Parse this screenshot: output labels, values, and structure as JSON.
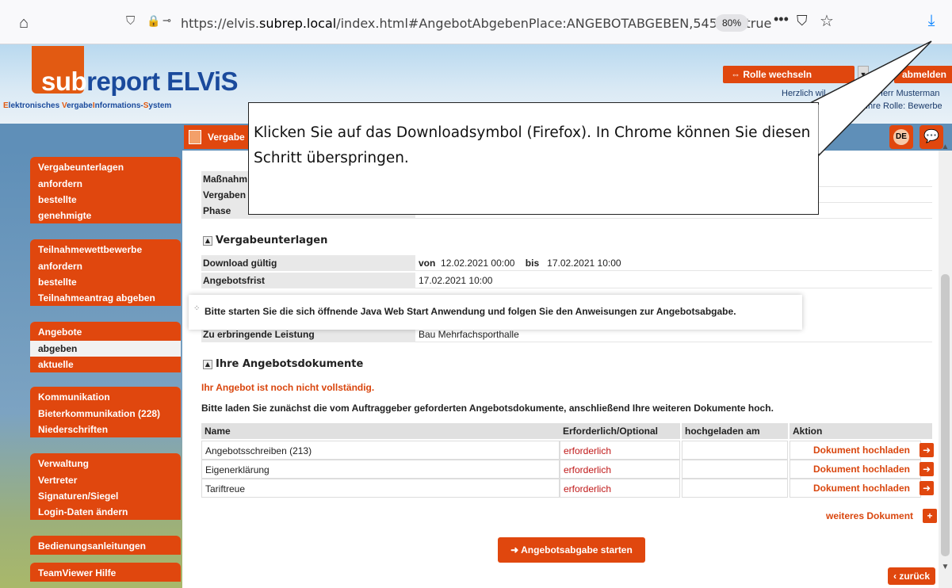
{
  "browser": {
    "url_prefix": "https://elvis.",
    "url_domain": "subrep.local",
    "url_suffix": "/index.html#AngebotAbgebenPlace:ANGEBOTABGEBEN,545673,true",
    "zoom": "80%"
  },
  "header": {
    "logo_sub": "sub",
    "logo_rest": "report ELViS",
    "logo_tagline_1": "E",
    "logo_tagline_2": "lektronisches ",
    "logo_tagline_3": "V",
    "logo_tagline_4": "ergabe",
    "logo_tagline_5": "I",
    "logo_tagline_6": "nformations-",
    "logo_tagline_7": "S",
    "logo_tagline_8": "ystem",
    "role_switch": "⇔ Rolle wechseln",
    "logout": "abmelden",
    "welcome": "Herzlich wil",
    "welcome_name": "Herr Musterman",
    "role_text": "Ihre Rolle: Bewerbe"
  },
  "nav": {
    "tab_label": "Vergabe",
    "lang": "DE"
  },
  "sidebar": {
    "groups": [
      {
        "title": "Vergabeunterlagen",
        "items": [
          "anfordern",
          "bestellte",
          "genehmigte"
        ]
      },
      {
        "title": "Teilnahmewettbewerbe",
        "items": [
          "anfordern",
          "bestellte",
          "Teilnahmeantrag abgeben"
        ]
      },
      {
        "title": "Angebote",
        "items": [
          "abgeben",
          "aktuelle"
        ]
      },
      {
        "title": "Kommunikation",
        "items": [
          "Bieterkommunikation (228)",
          "Niederschriften"
        ]
      },
      {
        "title": "Verwaltung",
        "items": [
          "Vertreter",
          "Signaturen/Siegel",
          "Login-Daten ändern"
        ]
      },
      {
        "title": "Bedienungsanleitungen",
        "items": []
      },
      {
        "title": "TeamViewer Hilfe",
        "items": []
      }
    ]
  },
  "main": {
    "top_rows": [
      {
        "key": "Maßnahm",
        "val": ""
      },
      {
        "key": "Vergaben",
        "val": ""
      },
      {
        "key": "Phase",
        "val": ""
      }
    ],
    "section_1": "Vergabeunterlagen",
    "download_key": "Download gültig",
    "download_von": "von",
    "download_from": "12.02.2021 00:00",
    "download_bis": "bis",
    "download_to": "17.02.2021 10:00",
    "deadline_key": "Angebotsfrist",
    "deadline_val": "17.02.2021 10:00",
    "service_key": "Zu erbringende Leistung",
    "service_val": "Bau Mehrfachsporthalle",
    "section_2": "Ihre Angebotsdokumente",
    "warning": "Ihr Angebot ist noch nicht vollständig.",
    "info": "Bitte laden Sie zunächst die vom Auftraggeber geforderten Angebotsdokumente, anschließend Ihre weiteren Dokumente hoch.",
    "table_headers": [
      "Name",
      "Erforderlich/Optional",
      "hochgeladen am",
      "Aktion"
    ],
    "table_rows": [
      {
        "name": "Angebotsschreiben (213)",
        "req": "erforderlich",
        "uploaded": "",
        "action": "Dokument hochladen"
      },
      {
        "name": "Eigenerklärung",
        "req": "erforderlich",
        "uploaded": "",
        "action": "Dokument hochladen"
      },
      {
        "name": "Tariftreue",
        "req": "erforderlich",
        "uploaded": "",
        "action": "Dokument hochladen"
      }
    ],
    "more_doc": "weiteres Dokument",
    "start_button": "Angebotsabgabe starten",
    "back_button": "zurück"
  },
  "java_notice": "Bitte starten Sie die sich öffnende Java Web Start Anwendung und folgen Sie den Anweisungen zur Angebotsabgabe.",
  "callout": {
    "text": "Klicken Sie auf das Downloadsymbol (Firefox). In Chrome können Sie diesen Schritt überspringen."
  }
}
